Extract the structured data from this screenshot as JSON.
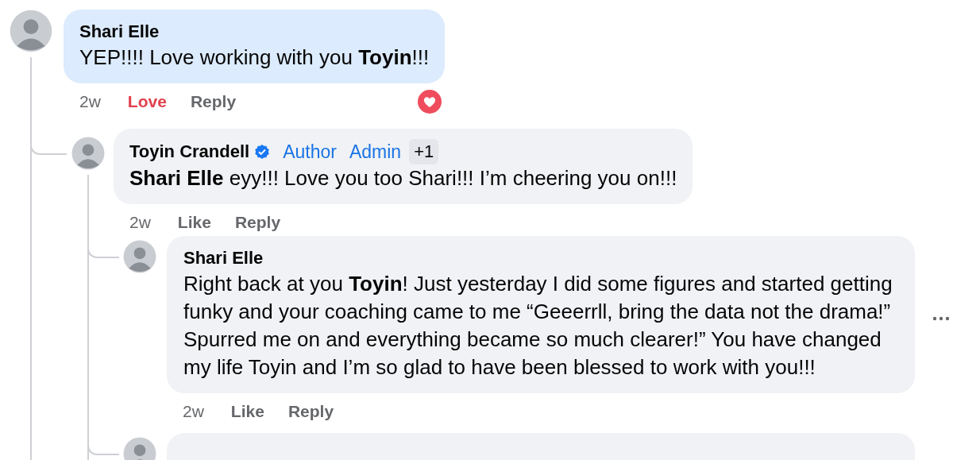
{
  "comments": [
    {
      "kind": "comment",
      "author": "Shari Elle",
      "highlighted": true,
      "text": "YEP!!!! Love working with you **Toyin**!!!",
      "time": "2w",
      "reaction": {
        "label": "Love",
        "selected": true
      },
      "reply": "Reply",
      "love_reaction": true,
      "children": [
        {
          "kind": "comment",
          "author": "Toyin Crandell",
          "verified": true,
          "badges": [
            "Author",
            "Admin"
          ],
          "more_badges": "+1",
          "highlighted": false,
          "text": "**Shari Elle** eyy!!! Love you too Shari!!! I’m cheering you on!!!",
          "time": "2w",
          "reaction": {
            "label": "Like",
            "selected": false
          },
          "reply": "Reply",
          "children": [
            {
              "kind": "comment",
              "author": "Shari Elle",
              "highlighted": false,
              "text": "Right back at you **Toyin**! Just yesterday I did some figures and started getting funky and your coaching came to me “Geeerrll, bring the data not the drama!” Spurred me on and everything became so much clearer!” You have changed my life Toyin and I’m so glad to have been blessed to work with you!!!",
              "time": "2w",
              "reaction": {
                "label": "Like",
                "selected": false
              },
              "reply": "Reply",
              "menu_visible": true
            },
            {
              "kind": "partial"
            }
          ]
        }
      ]
    }
  ]
}
